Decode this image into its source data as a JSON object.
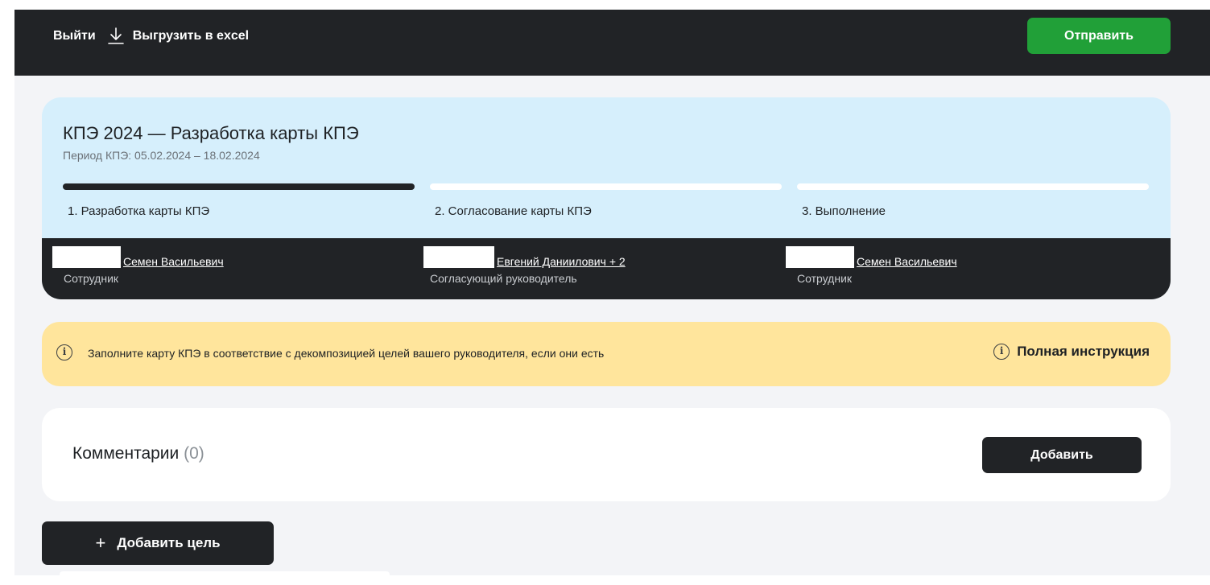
{
  "header": {
    "logout_label": "Выйти",
    "export_label": "Выгрузить в excel",
    "export_icon": "download-icon",
    "send_label": "Отправить",
    "send_color": "#21a038"
  },
  "kpi": {
    "title": "КПЭ 2024 — Разработка карты КПЭ",
    "period": "Период КПЭ: 05.02.2024 – 18.02.2024",
    "steps": [
      {
        "label": "1. Разработка карты КПЭ",
        "active": true
      },
      {
        "label": "2. Согласование карты КПЭ",
        "active": false
      },
      {
        "label": "3. Выполнение",
        "active": false
      }
    ],
    "people": [
      {
        "name": "Семен Васильевич",
        "extra": "",
        "role": "Сотрудник"
      },
      {
        "name": "Евгений Даниилович",
        "extra": " + 2",
        "role": "Согласующий руководитель"
      },
      {
        "name": "Семен Васильевич",
        "extra": "",
        "role": "Сотрудник"
      }
    ]
  },
  "banner": {
    "message": "Заполните карту КПЭ в соответствие с декомпозицией целей вашего руководителя, если они есть",
    "instruction_label": "Полная инструкция",
    "icon": "info-icon",
    "color": "#ffe59c"
  },
  "comments": {
    "title": "Комментарии",
    "count": "(0)",
    "add_label": "Добавить"
  },
  "goals": {
    "add_label": "Добавить цель"
  }
}
